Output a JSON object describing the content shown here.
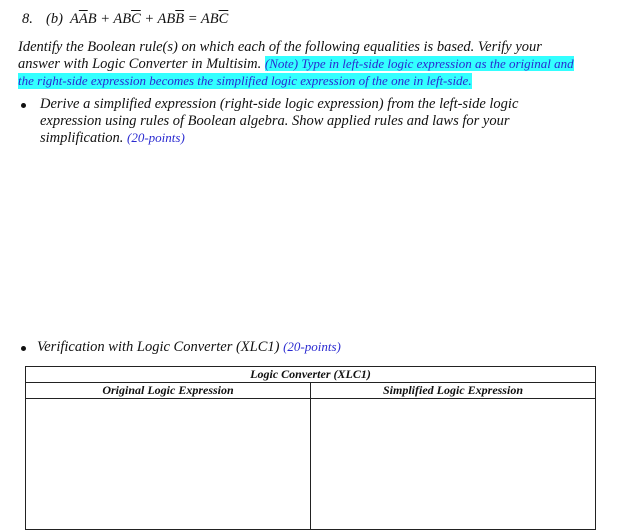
{
  "question": {
    "number": "8.",
    "part": "(b)",
    "equation": [
      {
        "t": "A",
        "o": false
      },
      {
        "t": "A",
        "o": true
      },
      {
        "t": "B",
        "o": false
      },
      {
        "t": " + AB",
        "o": false
      },
      {
        "t": "C",
        "o": true
      },
      {
        "t": " + AB",
        "o": false
      },
      {
        "t": "B",
        "o": true
      },
      {
        "t": " = AB",
        "o": false
      },
      {
        "t": "C",
        "o": true
      }
    ]
  },
  "instructions": {
    "line1": "Identify the Boolean rule(s) on which each of the following equalities is based. Verify your",
    "line2": "answer with Logic Converter in Multisim.",
    "note_part1": "(Note) Type in left-side logic expression as the original and",
    "note_part2": "the right-side expression becomes the simplified logic expression of the one in left-side."
  },
  "bullets": [
    {
      "lines": [
        "Derive a simplified expression (right-side logic expression) from the left-side logic",
        "expression using rules of Boolean algebra. Show applied rules and laws for your",
        "simplification."
      ],
      "points": "(20-points)"
    },
    {
      "lines": [
        "Verification with Logic Converter (XLC1)"
      ],
      "points": "(20-points)"
    }
  ],
  "table": {
    "title": "Logic Converter (XLC1)",
    "col1": "Original Logic Expression",
    "col2": "Simplified Logic Expression"
  }
}
